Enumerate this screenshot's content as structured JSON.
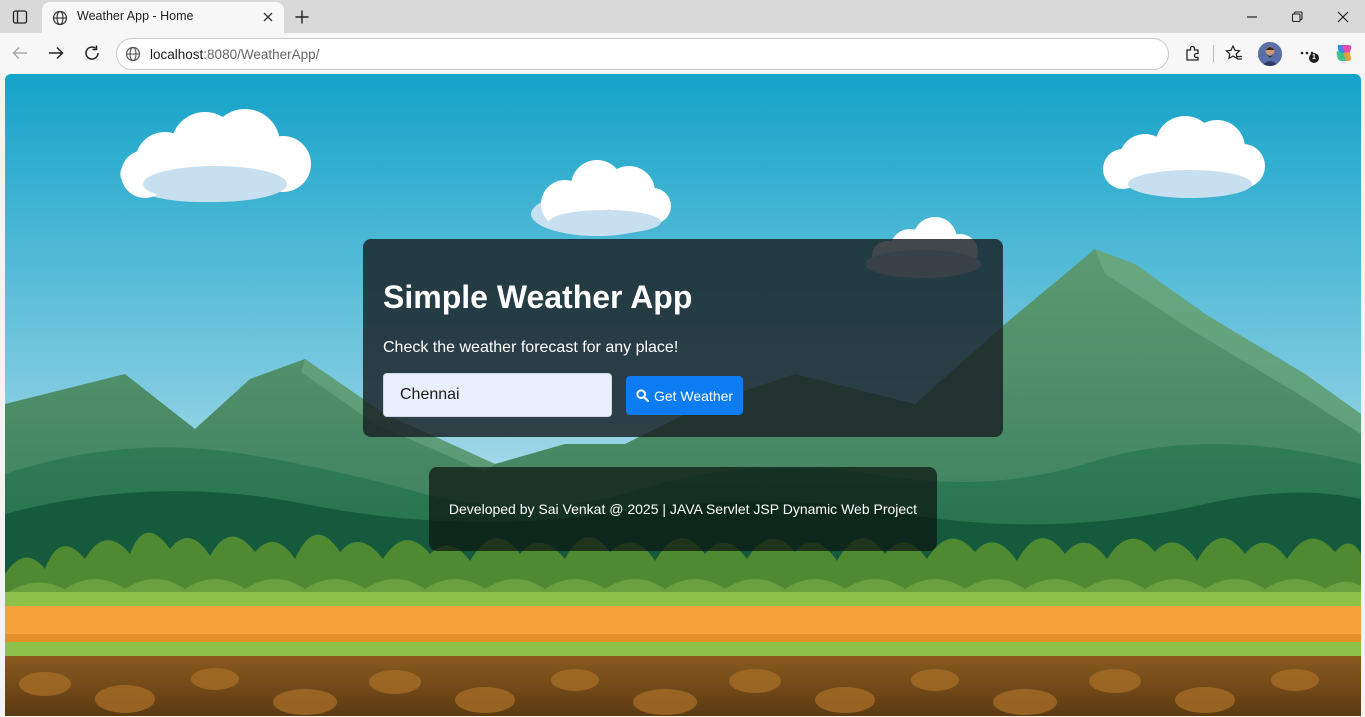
{
  "browser": {
    "tab_title": "Weather App - Home",
    "address": {
      "host": "localhost",
      "path": ":8080/WeatherApp/"
    }
  },
  "app": {
    "title": "Simple Weather App",
    "subtitle": "Check the weather forecast for any place!",
    "city_input_value": "Chennai",
    "button_label": "Get Weather",
    "button_icon": "search-icon",
    "footer_text": "Developed by Sai Venkat @ 2025 | JAVA Servlet JSP Dynamic Web Project"
  },
  "colors": {
    "button_bg": "#0d7cf2",
    "card_bg": "#191e23"
  }
}
